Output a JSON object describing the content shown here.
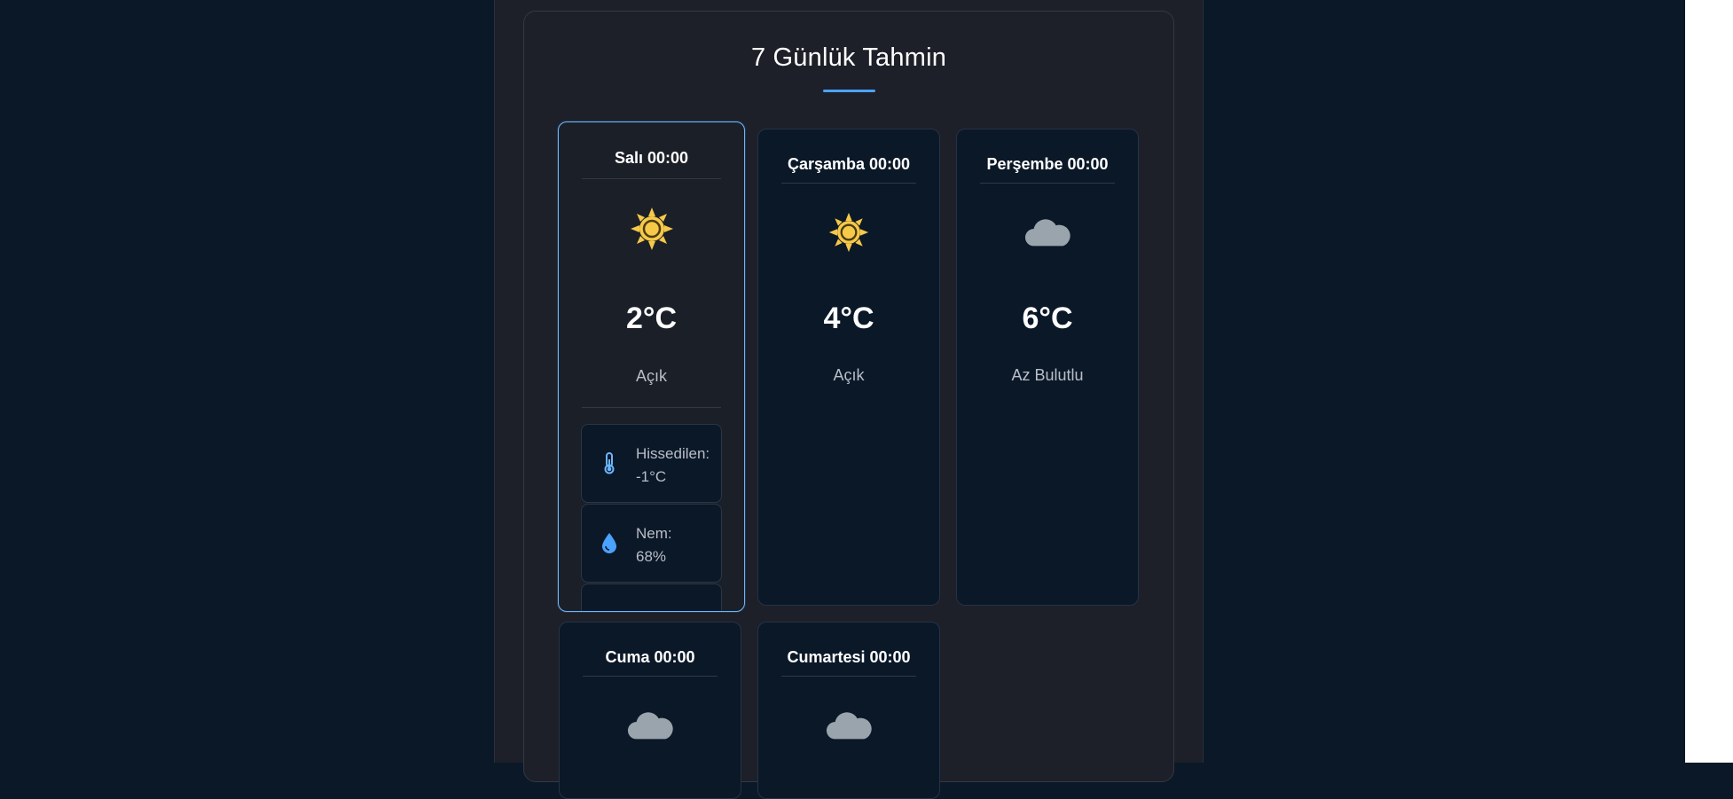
{
  "forecast": {
    "title": "7 Günlük Tahmin",
    "accent_color": "#4aa3ff",
    "cards": [
      {
        "day": "Salı 00:00",
        "icon": "sun-icon",
        "temp": "2°C",
        "desc": "Açık",
        "selected": true,
        "details": [
          {
            "icon": "thermometer-icon",
            "label": "Hissedilen:",
            "value": "-1°C"
          },
          {
            "icon": "droplet-icon",
            "label": "Nem:",
            "value": "68%"
          }
        ]
      },
      {
        "day": "Çarşamba 00:00",
        "icon": "sun-icon",
        "temp": "4°C",
        "desc": "Açık"
      },
      {
        "day": "Perşembe 00:00",
        "icon": "cloud-icon",
        "temp": "6°C",
        "desc": "Az Bulutlu"
      },
      {
        "day": "Cuma 00:00",
        "icon": "cloud-icon"
      },
      {
        "day": "Cumartesi 00:00",
        "icon": "cloud-icon"
      }
    ]
  }
}
